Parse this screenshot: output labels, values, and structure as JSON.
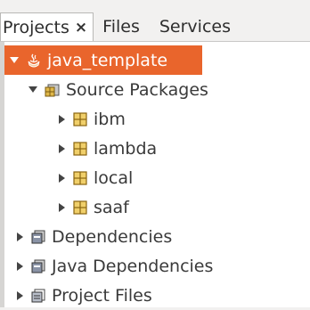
{
  "tabs": [
    {
      "label": "Projects",
      "close": "×",
      "active": true
    },
    {
      "label": "Files",
      "active": false
    },
    {
      "label": "Services",
      "active": false
    }
  ],
  "tree": {
    "project": {
      "label": "java_template",
      "icon": "java-project-icon",
      "expanded": true,
      "selected": true
    },
    "source_packages": {
      "label": "Source Packages",
      "icon": "source-packages-icon",
      "expanded": true
    },
    "packages": [
      {
        "label": "ibm",
        "icon": "package-icon"
      },
      {
        "label": "lambda",
        "icon": "package-icon"
      },
      {
        "label": "local",
        "icon": "package-icon"
      },
      {
        "label": "saaf",
        "icon": "package-icon"
      }
    ],
    "dependencies": {
      "label": "Dependencies",
      "icon": "library-icon"
    },
    "java_dependencies": {
      "label": "Java Dependencies",
      "icon": "library-icon"
    },
    "project_files": {
      "label": "Project Files",
      "icon": "project-files-icon"
    }
  },
  "colors": {
    "selection": "#e9652c",
    "package": "#e0b84a"
  }
}
